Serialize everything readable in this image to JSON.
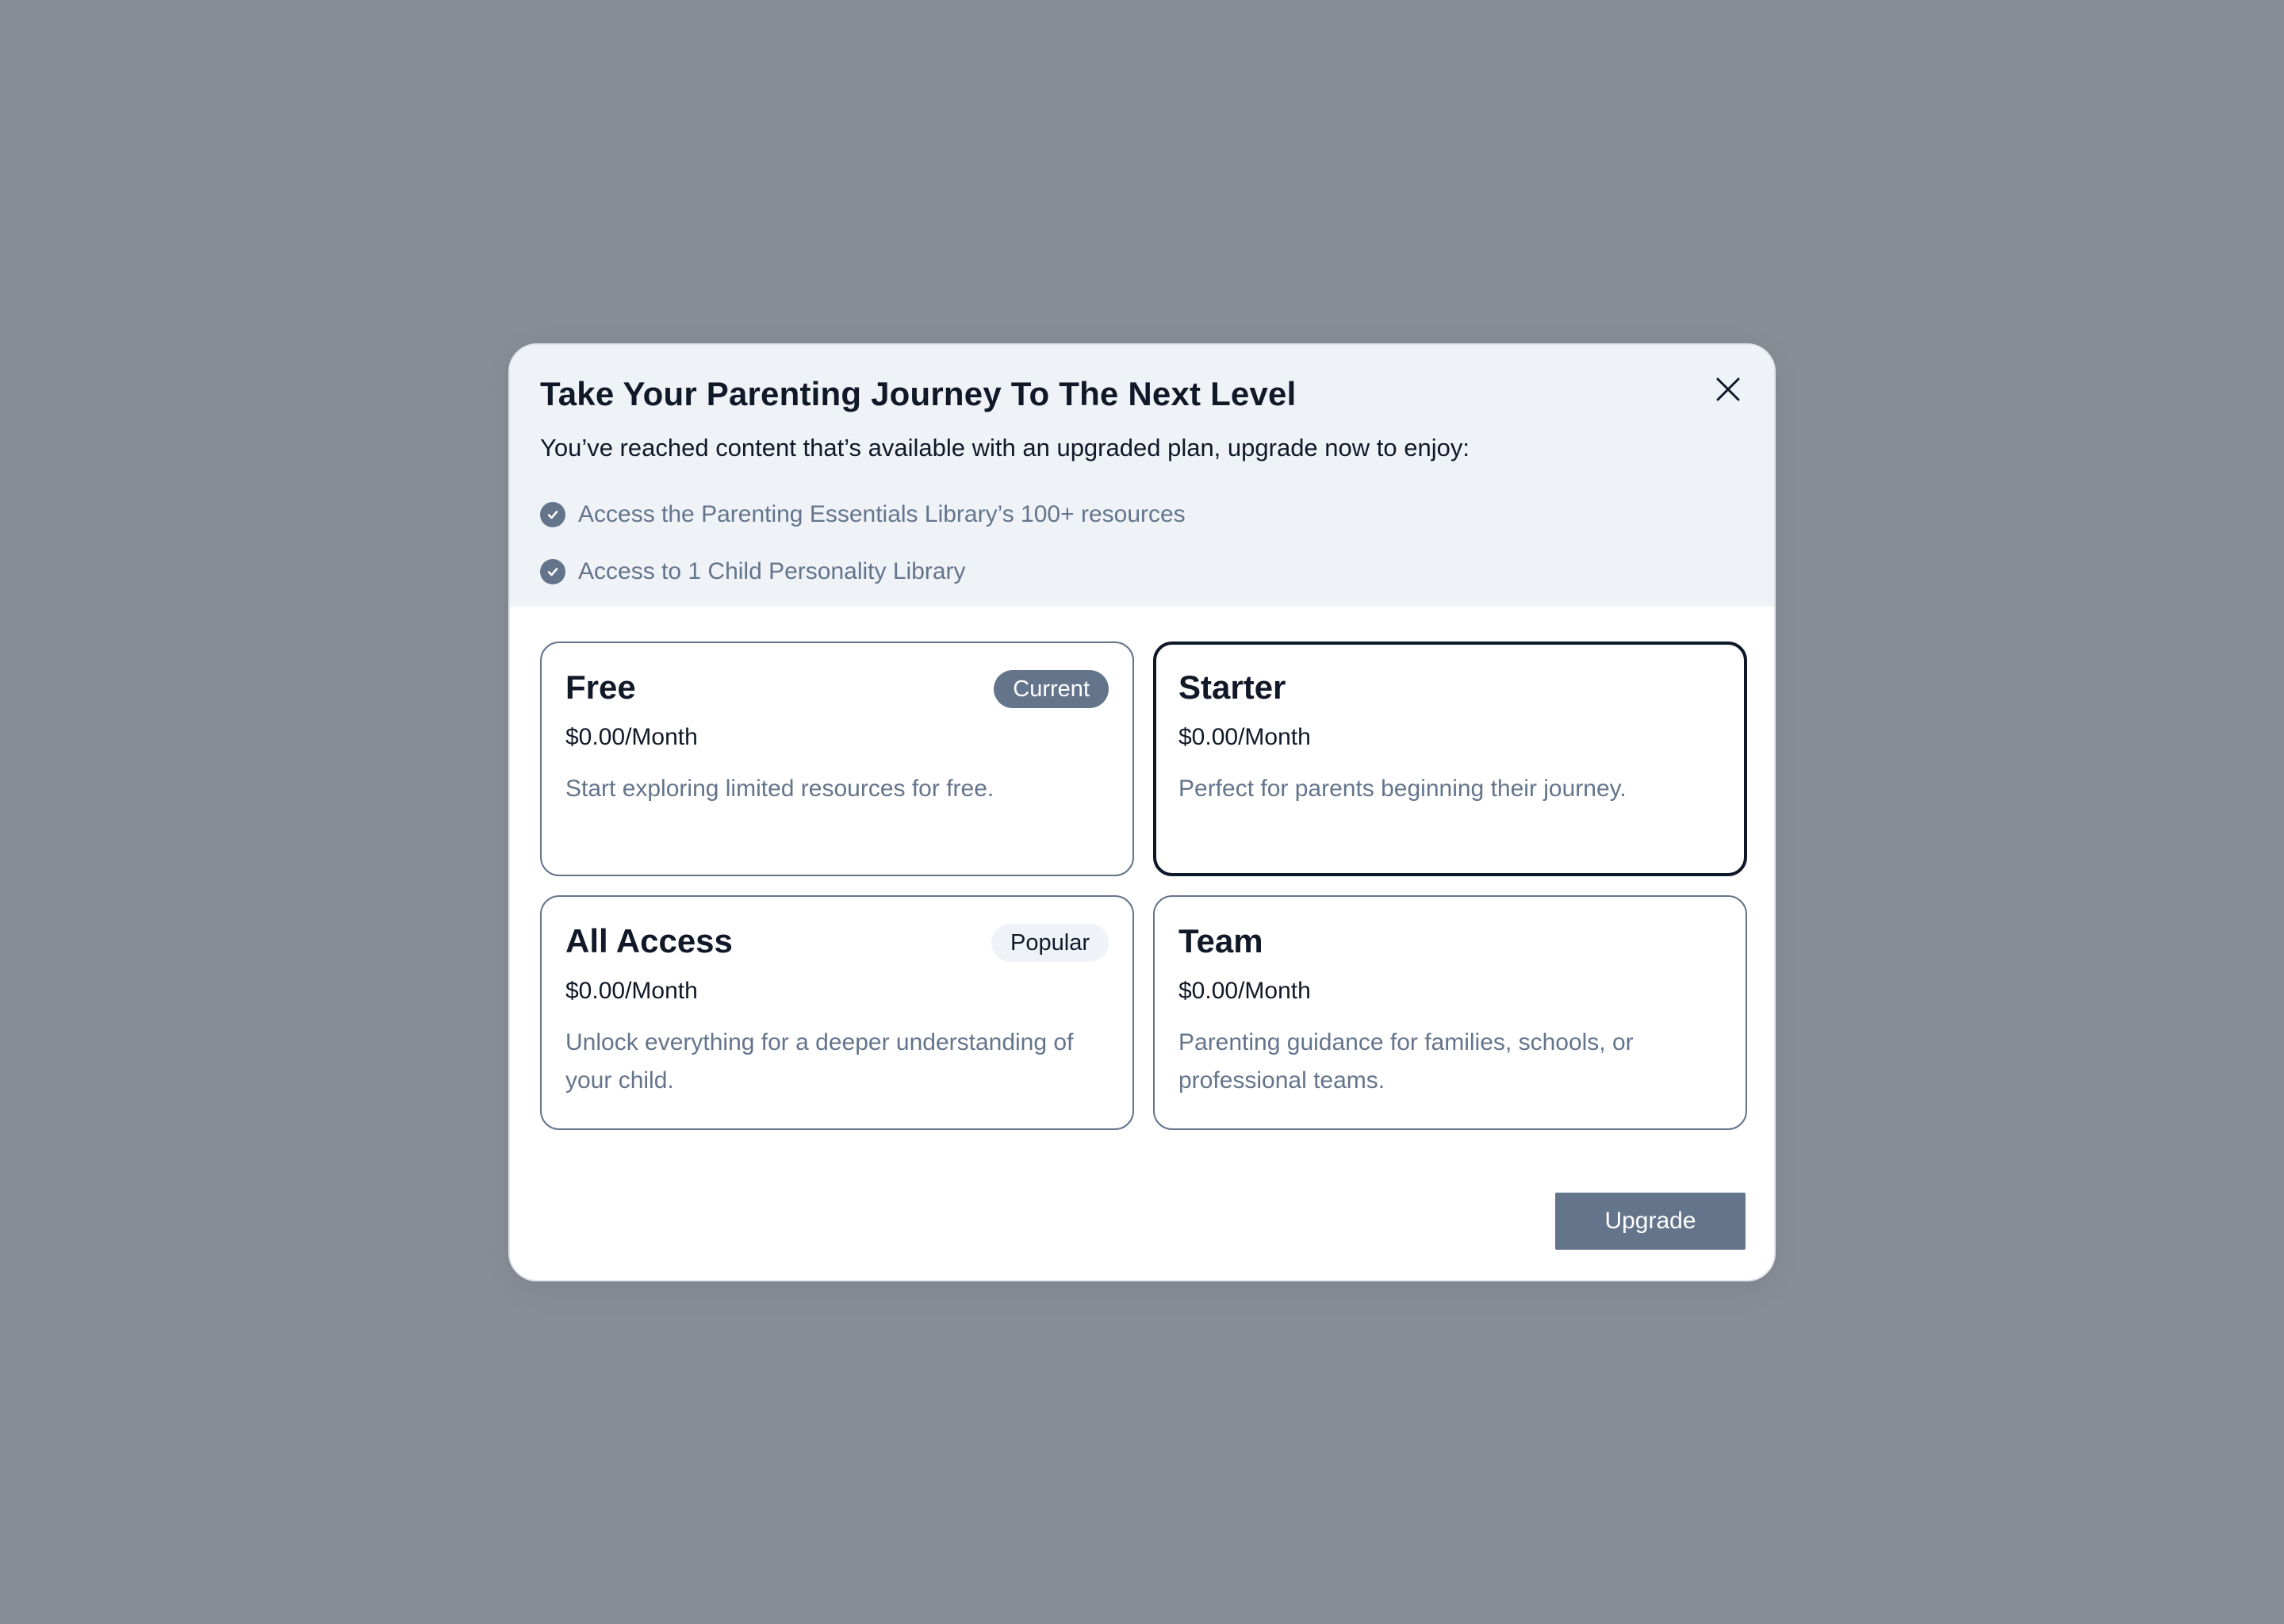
{
  "modal": {
    "title": "Take Your Parenting Journey To The Next Level",
    "subtitle": "You’ve reached content that’s available with an upgraded plan, upgrade now to enjoy:",
    "benefits": [
      "Access the Parenting Essentials Library’s 100+ resources",
      "Access to 1 Child Personality Library"
    ],
    "close_icon": "close-icon",
    "check_icon": "check-circle-icon"
  },
  "plans": [
    {
      "name": "Free",
      "price": "$0.00/Month",
      "description": "Start exploring limited resources for free.",
      "badge": "Current",
      "selected": false
    },
    {
      "name": "Starter",
      "price": "$0.00/Month",
      "description": "Perfect for parents beginning their journey.",
      "badge": "",
      "selected": true
    },
    {
      "name": "All Access",
      "price": "$0.00/Month",
      "description": "Unlock everything for a deeper understanding of your child.",
      "badge": "Popular",
      "selected": false
    },
    {
      "name": "Team",
      "price": "$0.00/Month",
      "description": "Parenting guidance for families, schools, or professional teams.",
      "badge": "",
      "selected": false
    }
  ],
  "actions": {
    "upgrade_label": "Upgrade"
  },
  "colors": {
    "backdrop": "#898d96",
    "header_bg": "#eff3f8",
    "accent": "#64748b",
    "text_dark": "#111827",
    "selected_border": "#0f172a"
  }
}
